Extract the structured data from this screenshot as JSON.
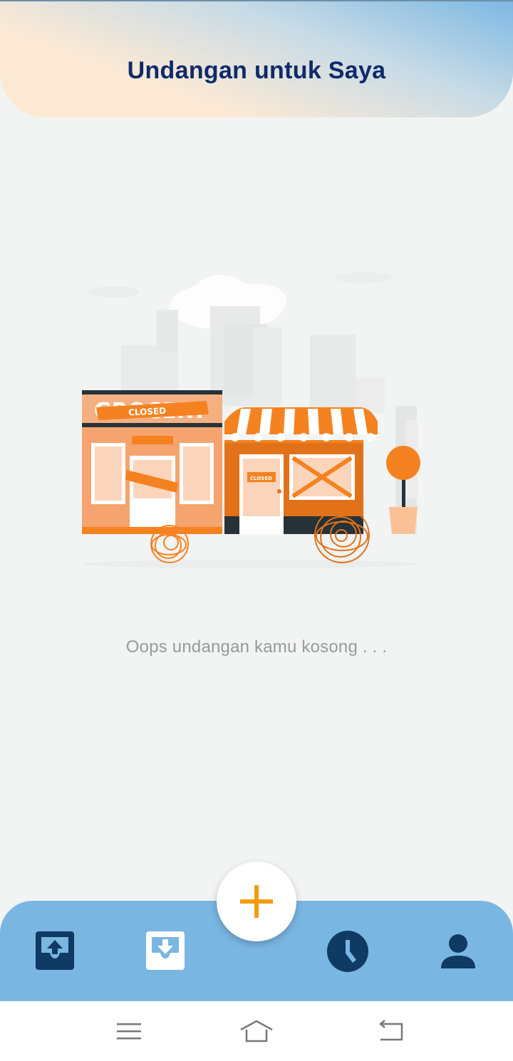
{
  "header": {
    "title": "Undangan untuk Saya"
  },
  "illustration": {
    "sign_text": "GROCERY",
    "banner_text": "CLOSED",
    "door_sign_text": "CLOSED"
  },
  "empty_state": {
    "message": "Oops undangan kamu kosong . . ."
  },
  "bottom_nav": {
    "items": [
      {
        "icon": "outbox-upload-icon"
      },
      {
        "icon": "inbox-download-icon",
        "active": true
      },
      {
        "icon": "add-icon"
      },
      {
        "icon": "clock-icon"
      },
      {
        "icon": "profile-icon"
      }
    ]
  },
  "colors": {
    "header_title": "#0f2a6b",
    "nav_bg": "#7ab6e2",
    "nav_icon": "#0e3a63",
    "fab_plus": "#f39c12",
    "store_orange": "#f58220"
  },
  "system_nav": {
    "buttons": [
      "menu-icon",
      "home-icon",
      "back-icon"
    ]
  }
}
